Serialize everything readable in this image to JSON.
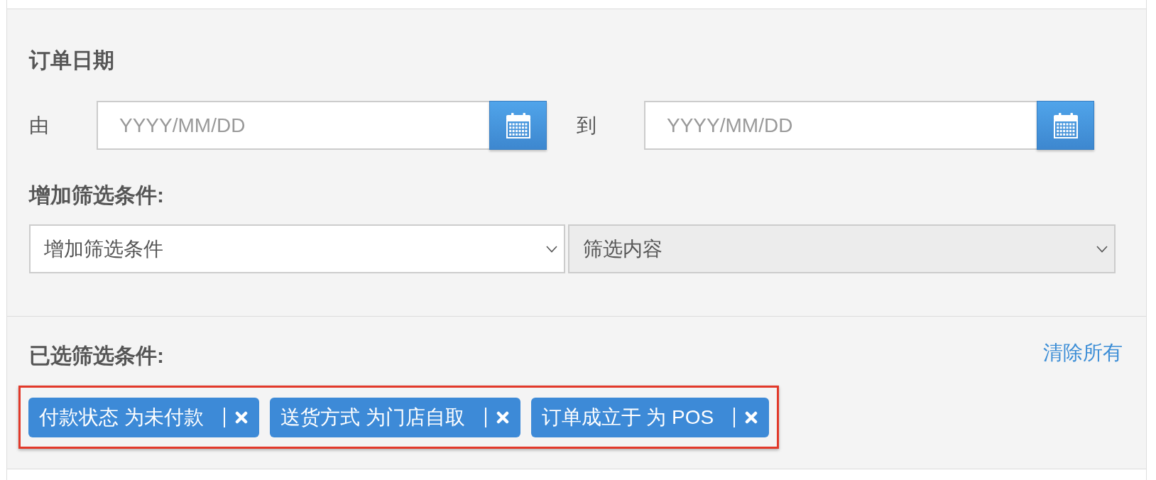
{
  "order_date": {
    "heading": "订单日期",
    "fields": [
      {
        "label": "由",
        "placeholder": "YYYY/MM/DD"
      },
      {
        "label": "到",
        "placeholder": "YYYY/MM/DD"
      }
    ]
  },
  "add_filter": {
    "heading": "增加筛选条件:",
    "selects": [
      {
        "value": "增加筛选条件",
        "disabled": false
      },
      {
        "value": "筛选内容",
        "disabled": true
      }
    ]
  },
  "selected_filters": {
    "heading": "已选筛选条件:",
    "clear_all": "清除所有",
    "highlighted": true,
    "chips": [
      {
        "label": "付款状态 为未付款"
      },
      {
        "label": "送货方式 为门店自取"
      },
      {
        "label": "订单成立于 为 POS"
      }
    ]
  }
}
